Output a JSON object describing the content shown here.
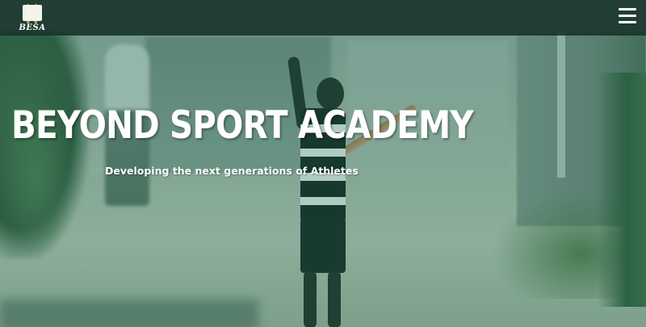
{
  "header": {
    "logo_text": "BESA",
    "menu_icon": "hamburger-menu-icon"
  },
  "hero": {
    "title": "BEYOND SPORT ACADEMY",
    "subtitle": "Developing the next generations of Athletes",
    "overlay_color": "#23785f"
  }
}
